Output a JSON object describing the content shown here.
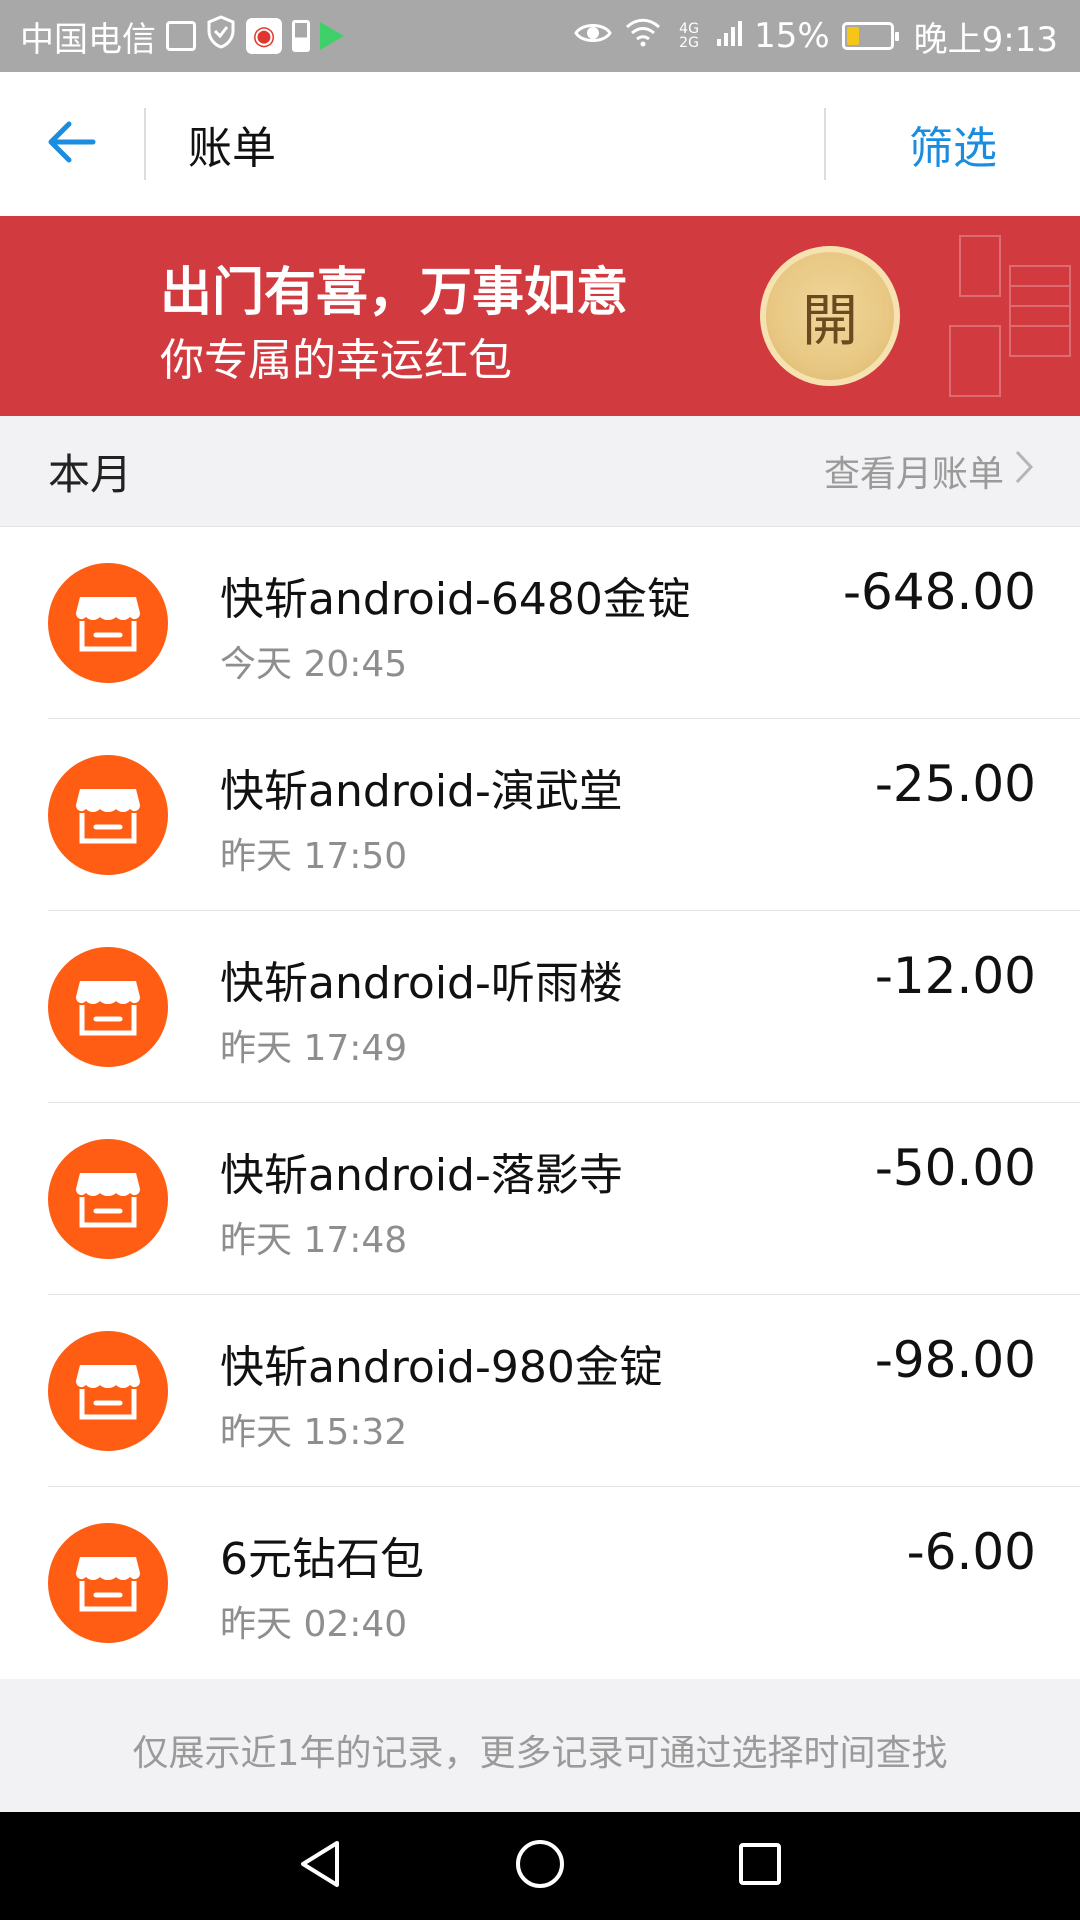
{
  "status_bar": {
    "carrier": "中国电信",
    "network": "4G 2G",
    "battery_percent": "15%",
    "time": "晚上9:13",
    "colors": {
      "background": "#a8a8a8",
      "battery_fill": "#f5c518"
    },
    "icons": [
      "sim-icon",
      "shield-icon",
      "weibo-icon",
      "battery-alert-icon",
      "play-icon",
      "eye-icon",
      "wifi-icon",
      "signal-icon",
      "battery-icon"
    ]
  },
  "header": {
    "title": "账单",
    "filter_label": "筛选",
    "back_icon": "arrow-left-icon",
    "colors": {
      "accent": "#1a8de0"
    }
  },
  "banner": {
    "title": "出门有喜，万事如意",
    "subtitle": "你专属的幸运红包",
    "coin_label": "開",
    "colors": {
      "background": "#d13b40",
      "coin": "#e8c883"
    }
  },
  "section": {
    "title": "本月",
    "link_label": "查看月账单",
    "link_icon": "chevron-right-icon"
  },
  "transactions": [
    {
      "title": "快斩android-6480金锭",
      "time": "今天 20:45",
      "amount": "-648.00",
      "icon": "shop-icon"
    },
    {
      "title": "快斩android-演武堂",
      "time": "昨天 17:50",
      "amount": "-25.00",
      "icon": "shop-icon"
    },
    {
      "title": "快斩android-听雨楼",
      "time": "昨天 17:49",
      "amount": "-12.00",
      "icon": "shop-icon"
    },
    {
      "title": "快斩android-落影寺",
      "time": "昨天 17:48",
      "amount": "-50.00",
      "icon": "shop-icon"
    },
    {
      "title": "快斩android-980金锭",
      "time": "昨天 15:32",
      "amount": "-98.00",
      "icon": "shop-icon"
    },
    {
      "title": "6元钻石包",
      "time": "昨天 02:40",
      "amount": "-6.00",
      "icon": "shop-icon"
    }
  ],
  "footer_note": "仅展示近1年的记录，更多记录可通过选择时间查找",
  "nav_bar": {
    "buttons": [
      "back-triangle-icon",
      "home-circle-icon",
      "recents-square-icon"
    ]
  },
  "colors": {
    "avatar": "#fe5d13"
  }
}
